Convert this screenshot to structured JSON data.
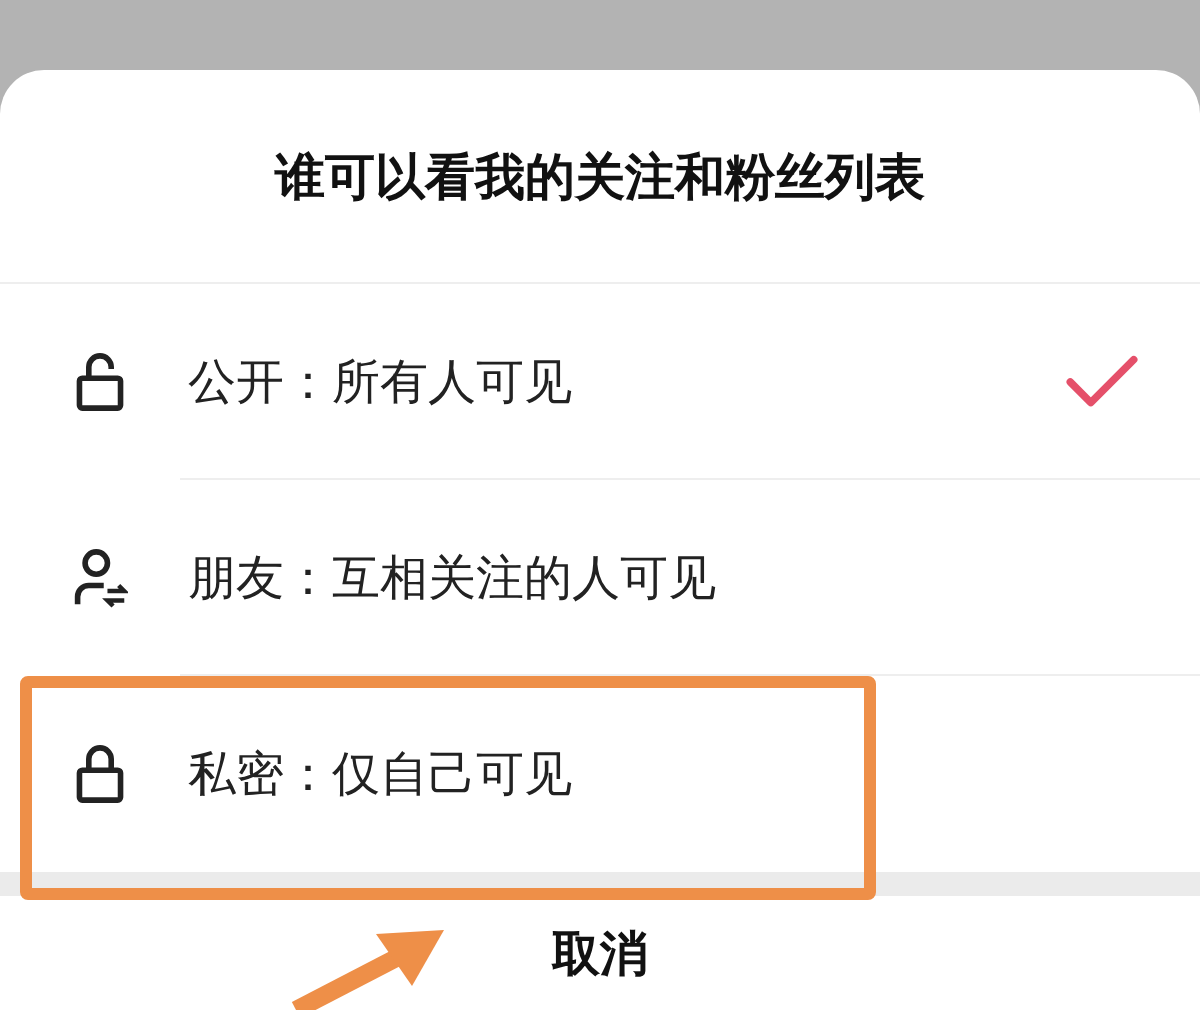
{
  "sheet": {
    "title": "谁可以看我的关注和粉丝列表",
    "options": [
      {
        "kind": "public",
        "label": "公开：所有人可见",
        "selected": true,
        "highlighted": false
      },
      {
        "kind": "friends",
        "label": "朋友：互相关注的人可见",
        "selected": false,
        "highlighted": false
      },
      {
        "kind": "private",
        "label": "私密：仅自己可见",
        "selected": false,
        "highlighted": true
      }
    ],
    "cancel": "取消"
  }
}
